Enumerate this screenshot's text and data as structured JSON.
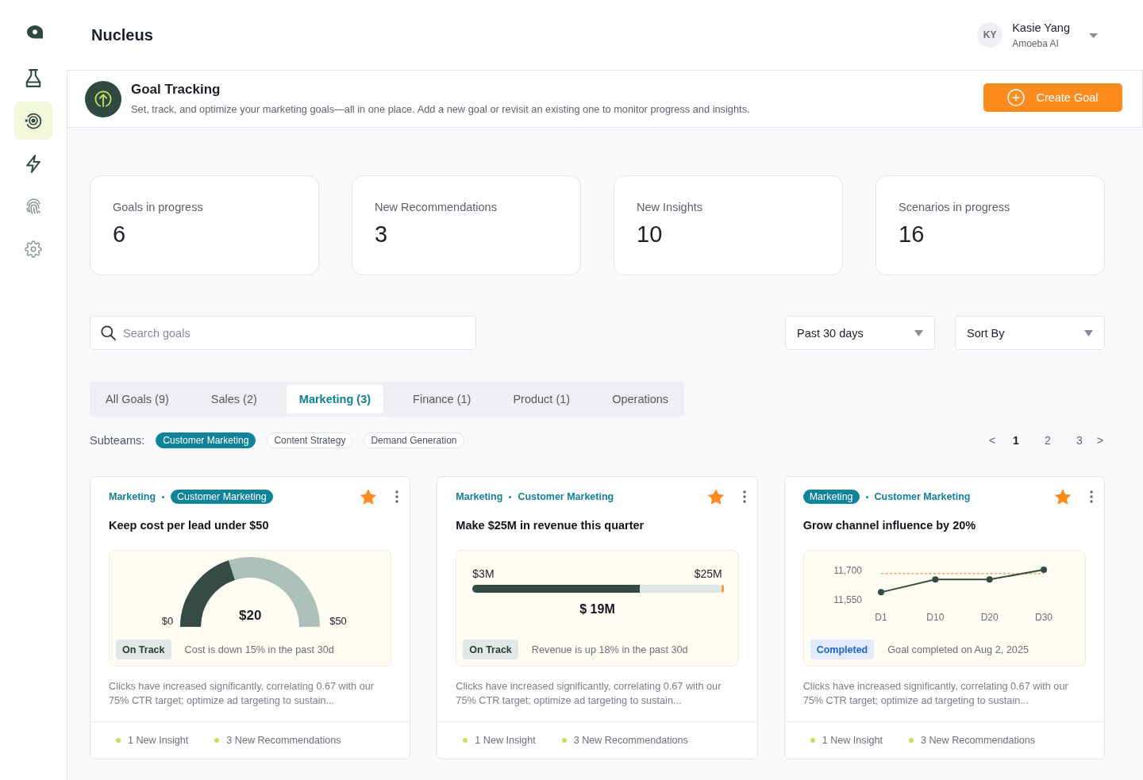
{
  "sidebar": {
    "items": [
      {
        "selected": false,
        "disabled": false
      },
      {
        "selected": true,
        "disabled": false
      },
      {
        "selected": false,
        "disabled": false
      },
      {
        "selected": false,
        "disabled": true
      },
      {
        "selected": false,
        "disabled": true
      }
    ]
  },
  "header": {
    "app_title": "Nucleus",
    "user": {
      "initials": "KY",
      "name": "Kasie Yang",
      "org": "Amoeba AI"
    }
  },
  "banner": {
    "title": "Goal Tracking",
    "subtitle": "Set, track, and optimize your marketing goals—all in one place. Add a new goal or revisit an existing one to monitor progress and insights.",
    "button": "Create Goal"
  },
  "stats": [
    {
      "label": "Goals in progress",
      "value": "6"
    },
    {
      "label": "New Recommendations",
      "value": "3"
    },
    {
      "label": "New Insights",
      "value": "10"
    },
    {
      "label": "Scenarios in progress",
      "value": "16"
    }
  ],
  "search": {
    "placeholder": "Search goals"
  },
  "dropdowns": [
    {
      "value": "Past 30 days"
    },
    {
      "value": "Sort By"
    }
  ],
  "tabs": [
    {
      "label": "All Goals (9)",
      "selected": false
    },
    {
      "label": "Sales (2)",
      "selected": false
    },
    {
      "label": "Marketing (3)",
      "selected": true
    },
    {
      "label": "Finance (1)",
      "selected": false
    },
    {
      "label": "Product (1)",
      "selected": false
    },
    {
      "label": "Operations",
      "selected": false
    }
  ],
  "subteams": {
    "label": "Subteams:",
    "chips": [
      {
        "label": "Customer Marketing",
        "selected": true
      },
      {
        "label": "Content Strategy",
        "selected": false
      },
      {
        "label": "Demand Generation",
        "selected": false
      }
    ]
  },
  "pagination": {
    "prev": "<",
    "next": ">",
    "pages": [
      {
        "label": "1",
        "selected": true
      },
      {
        "label": "2",
        "selected": false
      },
      {
        "label": "3",
        "selected": false
      }
    ]
  },
  "goals": [
    {
      "tags": [
        {
          "label": "Marketing",
          "highlighted": false
        },
        {
          "label": "Customer Marketing",
          "highlighted": true
        }
      ],
      "starred": true,
      "title": "Keep cost per lead under $50",
      "meter": {
        "kind": "gauge",
        "min_label": "$0",
        "max_label": "$50",
        "value_label": "$20",
        "level": 0.4
      },
      "status": {
        "kind": "on-track",
        "label": "On Track"
      },
      "status_note": "Cost is down 15% in the past 30d",
      "description": "Clicks have increased significantly, correlating 0.67 with our 75% CTR target; optimize ad targeting to sustain...",
      "footer": [
        "1 New Insight",
        "3 New Recommendations"
      ]
    },
    {
      "tags": [
        {
          "label": "Marketing",
          "highlighted": false
        },
        {
          "label": "Customer Marketing",
          "highlighted": false
        }
      ],
      "starred": true,
      "title": "Make $25M in revenue this quarter",
      "meter": {
        "kind": "progress",
        "min_label": "$3M",
        "max_label": "$25M",
        "value_label": "$ 19M",
        "level": 0.67
      },
      "status": {
        "kind": "on-track",
        "label": "On Track"
      },
      "status_note": "Revenue is up 18% in the past 30d",
      "description": "Clicks have increased significantly, correlating 0.67 with our 75% CTR target; optimize ad targeting to sustain...",
      "footer": [
        "1 New Insight",
        "3 New Recommendations"
      ]
    },
    {
      "tags": [
        {
          "label": "Marketing",
          "highlighted": true
        },
        {
          "label": "Customer Marketing",
          "highlighted": false
        }
      ],
      "starred": true,
      "title": "Grow channel influence by 20%",
      "meter": {
        "kind": "chart",
        "chart_data": {
          "type": "line",
          "categories": [
            "D1",
            "D10",
            "D20",
            "D30"
          ],
          "series": [
            {
              "color": "#344c44",
              "marker": "o",
              "values": [
                11585,
                11650,
                11650,
                11700
              ]
            }
          ],
          "ylim": [
            11550,
            11700
          ],
          "yticks": [
            {
              "value": 11700,
              "label": "11,700"
            },
            {
              "value": 11550,
              "label": "11,550"
            }
          ],
          "ref_lines": [
            {
              "axis": "y",
              "value": 11680,
              "color": "#f0923a"
            }
          ]
        }
      },
      "status": {
        "kind": "completed",
        "label": "Completed"
      },
      "status_note": "Goal completed on Aug 2, 2025",
      "description": "Clicks have increased significantly, correlating 0.67 with our 75% CTR target; optimize ad targeting to sustain...",
      "footer": [
        "1 New Insight",
        "3 New Recommendations"
      ]
    }
  ]
}
